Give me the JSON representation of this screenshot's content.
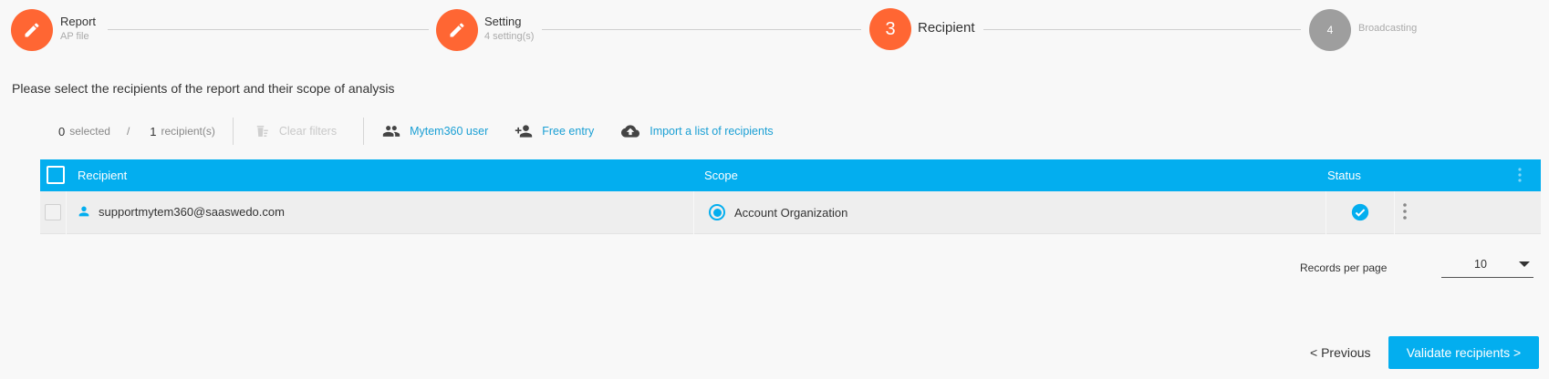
{
  "stepper": {
    "steps": [
      {
        "title": "Report",
        "subtitle": "AP file",
        "state": "done",
        "icon": "pencil-icon"
      },
      {
        "title": "Setting",
        "subtitle": "4 setting(s)",
        "state": "done",
        "icon": "pencil-icon"
      },
      {
        "number": "3",
        "title": "Recipient",
        "state": "active"
      },
      {
        "number": "4",
        "title": "Broadcasting",
        "state": "todo"
      }
    ]
  },
  "instruction": "Please select the recipients of the report and their scope of analysis",
  "toolbar": {
    "selected_count": "0",
    "selected_label": "selected",
    "slash": "/",
    "recipient_count": "1",
    "recipient_label": "recipient(s)",
    "clear_filters": "Clear filters",
    "mytem_user": "Mytem360 user",
    "free_entry": "Free entry",
    "import_list": "Import a list of recipients"
  },
  "table": {
    "headers": {
      "recipient": "Recipient",
      "scope": "Scope",
      "status": "Status"
    },
    "rows": [
      {
        "recipient": "supportmytem360@saaswedo.com",
        "scope": "Account Organization",
        "status": "valid"
      }
    ]
  },
  "pagination": {
    "records_per_page_label": "Records per page",
    "records_per_page_value": "10"
  },
  "footer": {
    "previous": "< Previous",
    "validate": "Validate recipients >"
  },
  "colors": {
    "accent": "#03aeef",
    "step_active": "#ff6633",
    "step_inactive": "#9e9e9e",
    "link": "#1a9fd4"
  }
}
